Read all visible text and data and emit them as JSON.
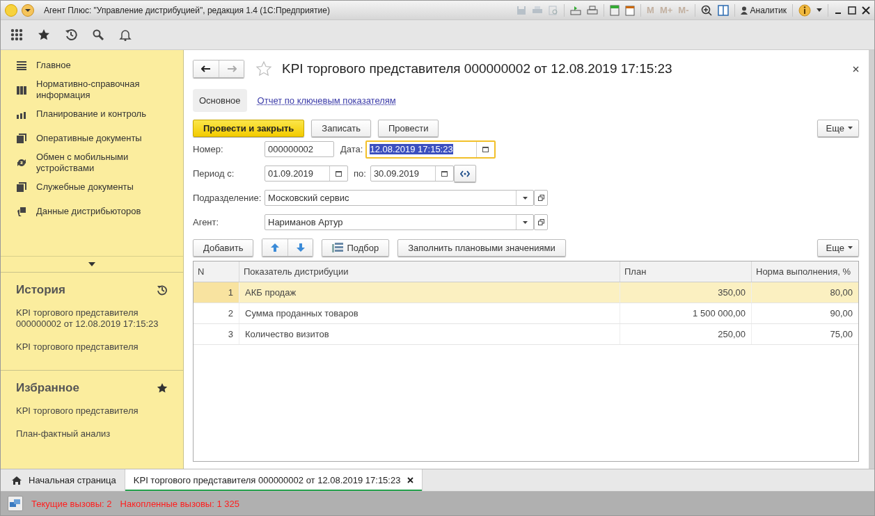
{
  "window": {
    "title": "Агент Плюс: \"Управление дистрибуцией\", редакция 1.4  (1С:Предприятие)",
    "memory_buttons": [
      {
        "label": "M",
        "disabled": true
      },
      {
        "label": "M+",
        "disabled": true
      },
      {
        "label": "M-",
        "disabled": true
      }
    ],
    "user": "Аналитик"
  },
  "sidebar": {
    "items": [
      {
        "label": "Главное"
      },
      {
        "label": "Нормативно-справочная информация"
      },
      {
        "label": "Планирование и контроль"
      },
      {
        "label": "Оперативные документы"
      },
      {
        "label": "Обмен с мобильными устройствами"
      },
      {
        "label": "Служебные документы"
      },
      {
        "label": "Данные дистрибьюторов"
      }
    ]
  },
  "history": {
    "title": "История",
    "items": [
      "KPI торгового представителя 000000002 от 12.08.2019 17:15:23",
      "KPI торгового представителя"
    ]
  },
  "favorites": {
    "title": "Избранное",
    "items": [
      "KPI торгового представителя",
      "План-фактный анализ"
    ]
  },
  "form": {
    "title": "KPI торгового представителя 000000002 от 12.08.2019 17:15:23",
    "tabs": [
      {
        "label": "Основное",
        "selected": true
      },
      {
        "label": "Отчет по ключевым показателям",
        "selected": false
      }
    ],
    "commands": [
      {
        "label": "Провести и закрыть",
        "kind": "primary"
      },
      {
        "label": "Записать",
        "kind": "normal"
      },
      {
        "label": "Провести",
        "kind": "normal"
      }
    ],
    "more": "Еще",
    "number_label": "Номер:",
    "number": "000000002",
    "date_label": "Дата:",
    "date": "12.08.2019 17:15:23",
    "date_focused": true,
    "period_label": "Период с:",
    "period_from": "01.09.2019",
    "period_to_label": "по:",
    "period_to": "30.09.2019",
    "department_label": "Подразделение:",
    "department": "Московский сервис",
    "agent_label": "Агент:",
    "agent": "Нариманов Артур",
    "table_buttons": {
      "add": "Добавить",
      "pick": "Подбор",
      "fill": "Заполнить плановыми значениями",
      "more": "Еще"
    },
    "table": {
      "columns": [
        "N",
        "Показатель дистрибуции",
        "План",
        "Норма выполнения, %"
      ],
      "rows": [
        {
          "n": "1",
          "indicator": "АКБ продаж",
          "plan": "350,00",
          "norm": "80,00",
          "selected": true
        },
        {
          "n": "2",
          "indicator": "Сумма проданных товаров",
          "plan": "1 500 000,00",
          "norm": "90,00",
          "selected": false
        },
        {
          "n": "3",
          "indicator": "Количество визитов",
          "plan": "250,00",
          "norm": "75,00",
          "selected": false
        }
      ]
    }
  },
  "open_tabs": [
    {
      "label": "Начальная страница",
      "kind": "home",
      "selected": false
    },
    {
      "label": "KPI торгового представителя 000000002 от 12.08.2019 17:15:23",
      "kind": "document",
      "selected": true
    }
  ],
  "status": {
    "current_calls": "Текущие вызовы: 2",
    "accumulated_calls": "Накопленные вызовы: 1 325"
  }
}
